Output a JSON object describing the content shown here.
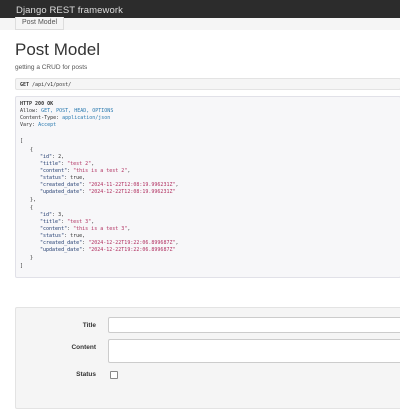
{
  "navbar": {
    "brand": "Django REST framework"
  },
  "breadcrumb": {
    "current": "Post Model"
  },
  "page": {
    "title": "Post Model",
    "description": "getting a CRUD for posts"
  },
  "request": {
    "method": "GET",
    "path": "/api/v1/post/"
  },
  "response": {
    "status_line": "HTTP 200 OK",
    "headers": [
      {
        "name": "Allow:",
        "value": "GET, POST, HEAD, OPTIONS"
      },
      {
        "name": "Content-Type:",
        "value": "application/json"
      },
      {
        "name": "Vary:",
        "value": "Accept"
      }
    ],
    "items": [
      {
        "id": "2",
        "title": "\"test 2\"",
        "content": "\"this is a test 2\"",
        "status": "true",
        "created_date": "\"2024-11-22T12:08:19.996231Z\"",
        "updated_date": "\"2024-12-22T12:08:19.996231Z\""
      },
      {
        "id": "3",
        "title": "\"test 3\"",
        "content": "\"this is a test 3\"",
        "status": "true",
        "created_date": "\"2024-12-22T19:22:06.899687Z\"",
        "updated_date": "\"2024-12-22T19:22:06.899687Z\""
      }
    ]
  },
  "form": {
    "title_label": "Title",
    "content_label": "Content",
    "status_label": "Status",
    "status_checked": false
  },
  "colors": {
    "navbar": "#2c2c2c",
    "string_value": "#b13060",
    "header_value": "#2a7ab0"
  }
}
